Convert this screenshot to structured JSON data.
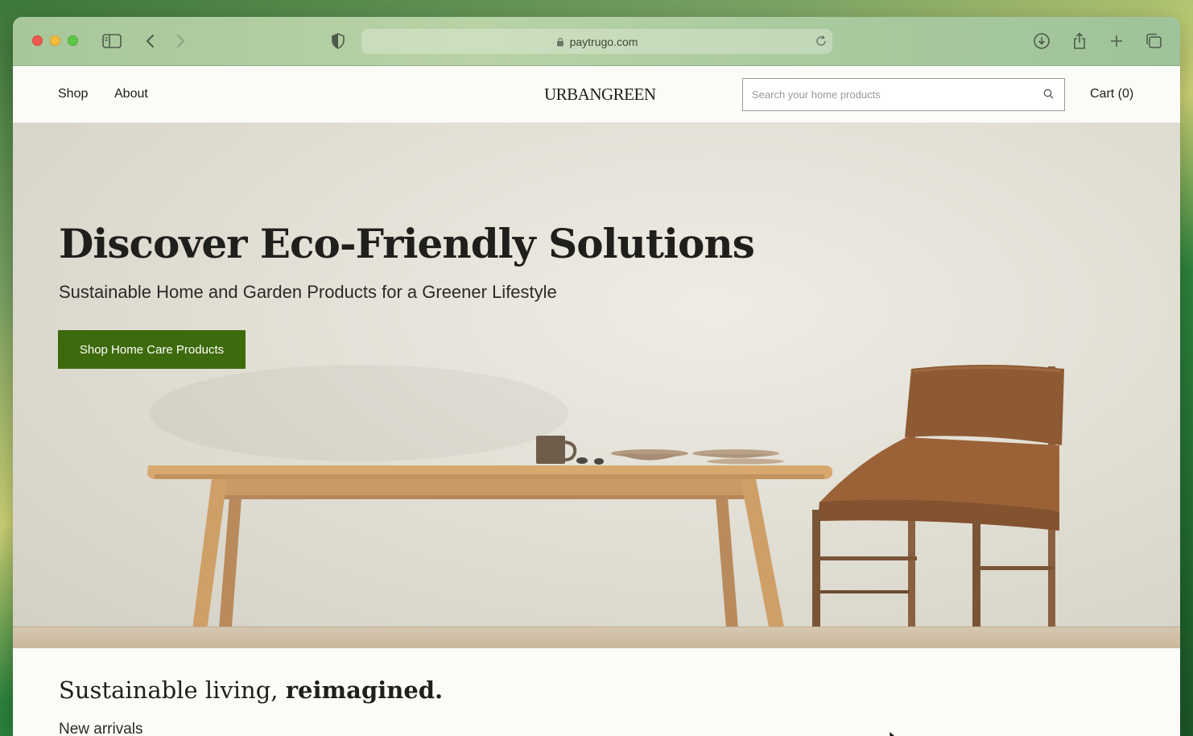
{
  "browser": {
    "url": "paytrugo.com"
  },
  "header": {
    "nav": [
      {
        "label": "Shop"
      },
      {
        "label": "About"
      }
    ],
    "logo": "URBANGREEN",
    "search": {
      "placeholder": "Search your home products",
      "value": ""
    },
    "cart_label": "Cart (0)"
  },
  "hero": {
    "title": "Discover Eco-Friendly Solutions",
    "subtitle": "Sustainable Home and Garden Products for a Greener Lifestyle",
    "cta_label": "Shop Home Care Products"
  },
  "section": {
    "tagline_regular": "Sustainable living, ",
    "tagline_bold": "reimagined.",
    "subheading": "New arrivals"
  },
  "colors": {
    "cta_background": "#3d6a0d",
    "page_background": "#fbfbf8"
  }
}
